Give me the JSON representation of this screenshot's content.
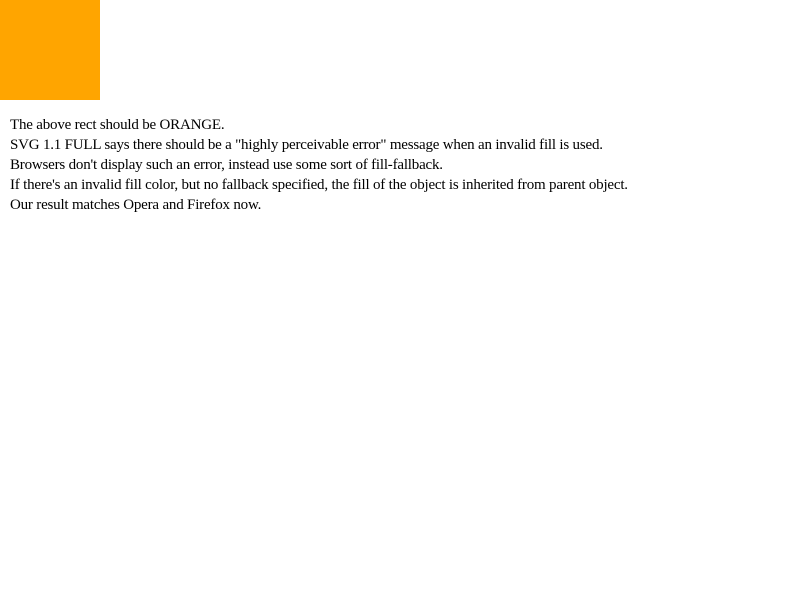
{
  "swatch": {
    "fill_color": "#FFA500"
  },
  "notes": {
    "lines": [
      "The above rect should be ORANGE.",
      "SVG 1.1 FULL says there should be a \"highly perceivable error\" message when an invalid fill is used.",
      "Browsers don't display such an error, instead use some sort of fill-fallback.",
      "If there's an invalid fill color, but no fallback specified, the fill of the object is inherited from parent object.",
      "Our result matches Opera and Firefox now."
    ]
  }
}
